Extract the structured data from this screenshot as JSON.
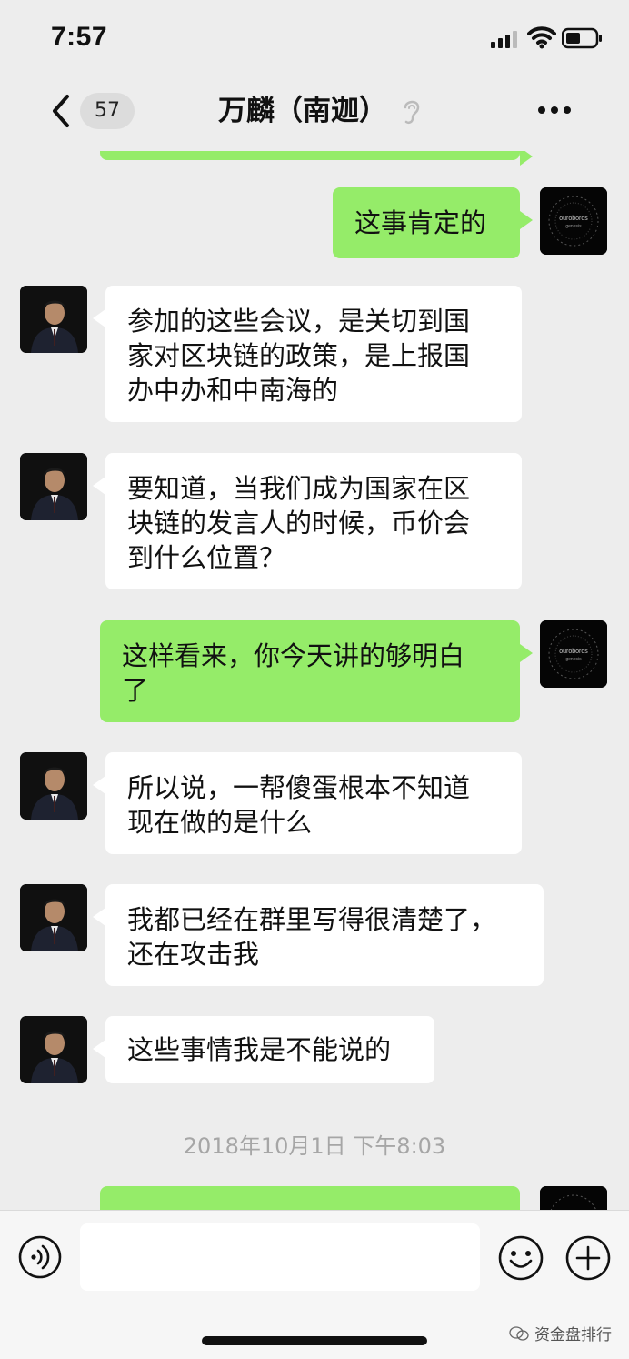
{
  "status_bar": {
    "time": "7:57"
  },
  "nav": {
    "unread_count": "57",
    "title": "万麟（南迦）",
    "icons": [
      "back-chevron-icon",
      "ear-icon",
      "more-icon"
    ]
  },
  "avatar_self_text": "ouroboros",
  "avatar_self_subtext": "genesis",
  "messages": [
    {
      "side": "out",
      "lines": [
        "这事肯定的"
      ]
    },
    {
      "side": "in",
      "lines": [
        "参加的这些会议，是关切到国",
        "家对区块链的政策，是上报国",
        "办中办和中南海的"
      ]
    },
    {
      "side": "in",
      "lines": [
        "要知道，当我们成为国家在区",
        "块链的发言人的时候，币价会",
        "到什么位置？"
      ]
    },
    {
      "side": "out",
      "lines": [
        "这样看来，你今天讲的够明白",
        "了"
      ]
    },
    {
      "side": "in",
      "lines": [
        "所以说，一帮傻蛋根本不知道",
        "现在做的是什么"
      ]
    },
    {
      "side": "in",
      "lines": [
        "我都已经在群里写得很清楚了，",
        "还在攻击我"
      ]
    },
    {
      "side": "in",
      "lines": [
        "这些事情我是不能说的"
      ]
    }
  ],
  "timestamp": "2018年10月1日 下午8:03",
  "input_bar": {
    "input_value": "",
    "icons": [
      "voice-icon",
      "emoji-icon",
      "plus-icon"
    ]
  },
  "watermark": "资金盘排行",
  "colors": {
    "background": "#ededed",
    "bubble_out": "#95ec69",
    "bubble_in": "#ffffff",
    "timestamp": "#a6a6a6"
  }
}
